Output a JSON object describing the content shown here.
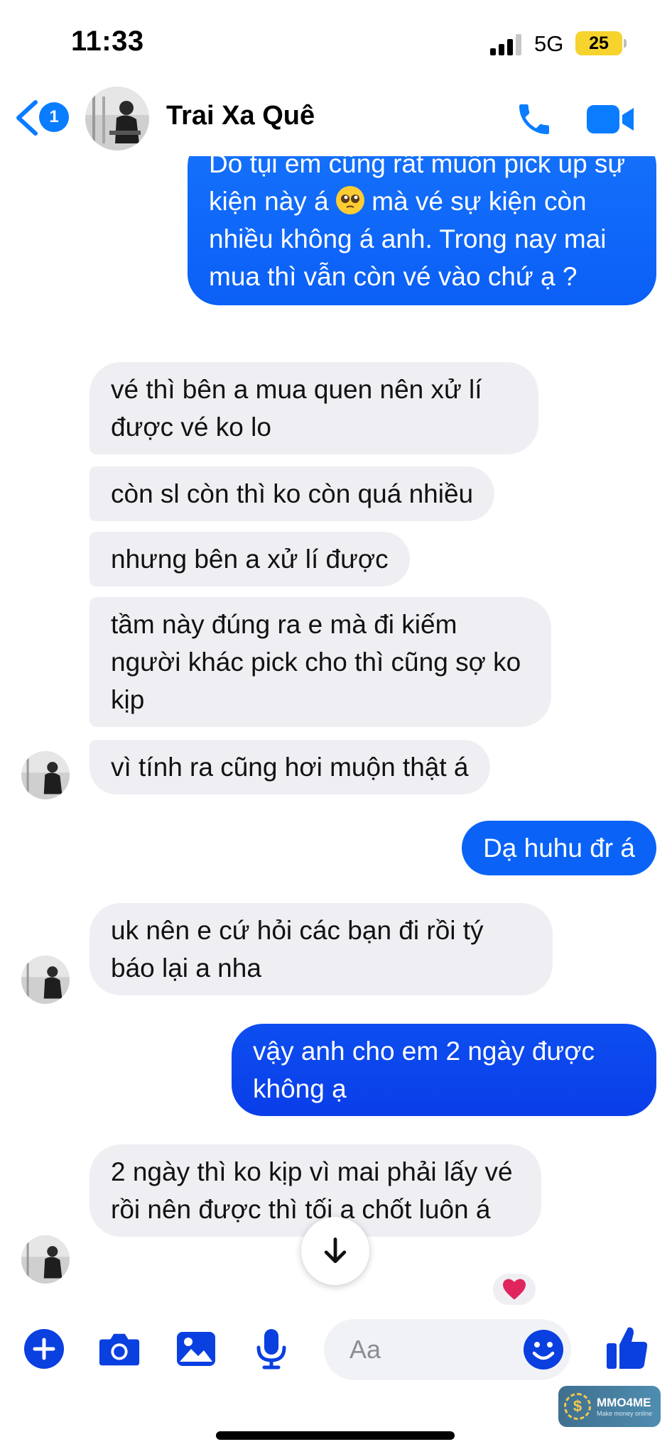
{
  "status_bar": {
    "time": "11:33",
    "network": "5G",
    "battery": "25"
  },
  "header": {
    "unread_count": "1",
    "contact_name": "Trai Xa Quê"
  },
  "messages": [
    {
      "from": "me",
      "text_before_emoji": "Do tụi em cũng rất muốn pick up sự kiện này á",
      "text_after_emoji": "mà vé sự kiện còn nhiều không á anh. Trong nay mai mua thì vẫn còn vé vào chứ ạ ?"
    },
    {
      "from": "contact",
      "text": "vé thì bên a mua quen nên xử lí được vé ko lo"
    },
    {
      "from": "contact",
      "text": "còn sl còn thì ko còn quá nhiều"
    },
    {
      "from": "contact",
      "text": "nhưng bên a xử lí được"
    },
    {
      "from": "contact",
      "text": "tầm này đúng ra e mà đi kiếm người khác pick cho thì cũng sợ ko kịp"
    },
    {
      "from": "contact",
      "text": "vì tính ra cũng hơi muộn thật á"
    },
    {
      "from": "me",
      "text": "Dạ huhu đr á"
    },
    {
      "from": "contact",
      "text": "uk nên e cứ hỏi các bạn đi rồi tý báo lại a nha"
    },
    {
      "from": "me",
      "text": "vậy anh cho em 2 ngày được không ạ"
    },
    {
      "from": "contact",
      "text": "2 ngày thì ko kịp vì mai phải lấy vé rồi nên được thì tối a chốt luôn á",
      "reaction": "heart"
    }
  ],
  "composer": {
    "placeholder": "Aa"
  },
  "watermark": {
    "brand": "MMO4ME",
    "tagline": "Make money online"
  },
  "colors": {
    "accent": "#0a7cff",
    "outgoing": "#0a63f6",
    "incoming": "#efeff3"
  }
}
